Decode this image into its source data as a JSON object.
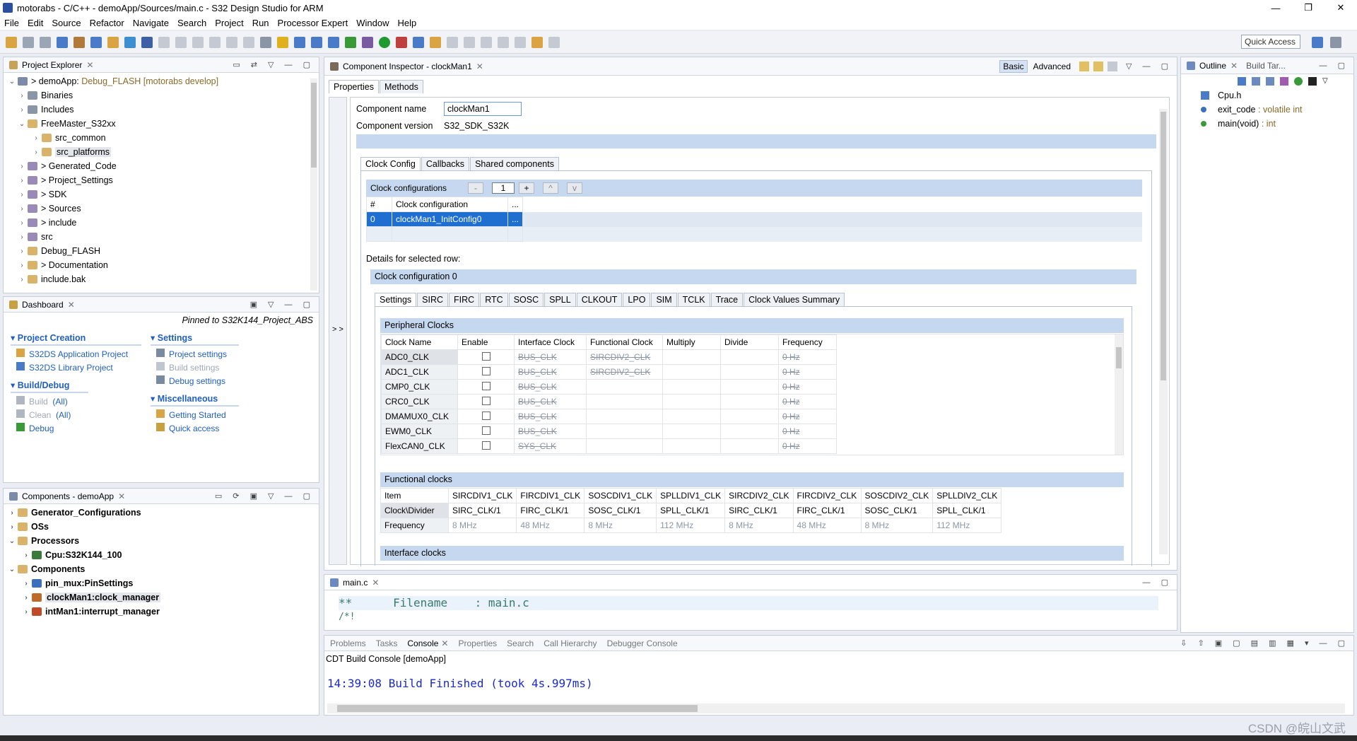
{
  "window": {
    "title": "motorabs - C/C++ - demoApp/Sources/main.c - S32 Design Studio for ARM",
    "controls": [
      "—",
      "❐",
      "✕"
    ]
  },
  "menu": [
    "File",
    "Edit",
    "Source",
    "Refactor",
    "Navigate",
    "Search",
    "Project",
    "Run",
    "Processor Expert",
    "Window",
    "Help"
  ],
  "toolbar": {
    "quick_access": "Quick Access"
  },
  "project_explorer": {
    "title": "Project Explorer",
    "items": [
      {
        "label": "> demoApp:",
        "extra": "Debug_FLASH [motorabs develop]"
      },
      {
        "label": "Binaries"
      },
      {
        "label": "Includes"
      },
      {
        "label": "FreeMaster_S32xx"
      },
      {
        "label": "src_common"
      },
      {
        "label": "src_platforms"
      },
      {
        "label": "> Generated_Code"
      },
      {
        "label": "> Project_Settings"
      },
      {
        "label": "> SDK"
      },
      {
        "label": "> Sources"
      },
      {
        "label": "> include"
      },
      {
        "label": "src"
      },
      {
        "label": "Debug_FLASH"
      },
      {
        "label": "> Documentation"
      },
      {
        "label": "include.bak"
      }
    ]
  },
  "dashboard": {
    "title": "Dashboard",
    "pinned": "Pinned to S32K144_Project_ABS",
    "project_creation": {
      "title": "Project Creation",
      "items": [
        "S32DS Application Project",
        "S32DS Library Project"
      ]
    },
    "build_debug": {
      "title": "Build/Debug",
      "items": [
        {
          "a": "Build",
          "b": "(All)"
        },
        {
          "a": "Clean",
          "b": "(All)"
        },
        {
          "a": "Debug",
          "b": ""
        }
      ]
    },
    "settings": {
      "title": "Settings",
      "items": [
        "Project settings",
        "Build settings",
        "Debug settings"
      ]
    },
    "misc": {
      "title": "Miscellaneous",
      "items": [
        "Getting Started",
        "Quick access"
      ]
    }
  },
  "components": {
    "title": "Components - demoApp",
    "items": [
      "Generator_Configurations",
      "OSs",
      "Processors",
      "Cpu:S32K144_100",
      "Components",
      "pin_mux:PinSettings",
      "clockMan1:clock_manager",
      "intMan1:interrupt_manager"
    ]
  },
  "inspector": {
    "title": "Component Inspector - clockMan1",
    "modes": [
      "Basic",
      "Advanced"
    ],
    "tabs": [
      "Properties",
      "Methods"
    ],
    "collapse": "> >",
    "name_label": "Component name",
    "name_value": "clockMan1",
    "version_label": "Component version",
    "version_value": "S32_SDK_S32K",
    "subtabs": [
      "Clock Config",
      "Callbacks",
      "Shared components"
    ],
    "clock_configs_label": "Clock configurations",
    "clock_configs_buttons": [
      "-",
      "1",
      "+",
      "^",
      "v"
    ],
    "cfg_headers": [
      "#",
      "Clock configuration",
      "..."
    ],
    "cfg_row": [
      "0",
      "clockMan1_InitConfig0",
      "..."
    ],
    "details_label": "Details for selected row:",
    "config0": "Clock configuration 0",
    "clock_tabs": [
      "Settings",
      "SIRC",
      "FIRC",
      "RTC",
      "SOSC",
      "SPLL",
      "CLKOUT",
      "LPO",
      "SIM",
      "TCLK",
      "Trace",
      "Clock Values Summary"
    ],
    "peripheral_title": "Peripheral Clocks",
    "peripheral_headers": [
      "Clock Name",
      "Enable",
      "Interface Clock",
      "Functional Clock",
      "Multiply",
      "Divide",
      "Frequency"
    ],
    "peripheral_rows": [
      [
        "ADC0_CLK",
        "BUS_CLK",
        "SIRCDIV2_CLK",
        "0 Hz"
      ],
      [
        "ADC1_CLK",
        "BUS_CLK",
        "SIRCDIV2_CLK",
        "0 Hz"
      ],
      [
        "CMP0_CLK",
        "BUS_CLK",
        "",
        "0 Hz"
      ],
      [
        "CRC0_CLK",
        "BUS_CLK",
        "",
        "0 Hz"
      ],
      [
        "DMAMUX0_CLK",
        "BUS_CLK",
        "",
        "0 Hz"
      ],
      [
        "EWM0_CLK",
        "BUS_CLK",
        "",
        "0 Hz"
      ],
      [
        "FlexCAN0_CLK",
        "SYS_CLK",
        "",
        "0 Hz"
      ]
    ],
    "functional_title": "Functional clocks",
    "functional_headers": [
      "Item",
      "SIRCDIV1_CLK",
      "FIRCDIV1_CLK",
      "SOSCDIV1_CLK",
      "SPLLDIV1_CLK",
      "SIRCDIV2_CLK",
      "FIRCDIV2_CLK",
      "SOSCDIV2_CLK",
      "SPLLDIV2_CLK"
    ],
    "functional_div": [
      "Clock\\Divider",
      "SIRC_CLK/1",
      "FIRC_CLK/1",
      "SOSC_CLK/1",
      "SPLL_CLK/1",
      "SIRC_CLK/1",
      "FIRC_CLK/1",
      "SOSC_CLK/1",
      "SPLL_CLK/1"
    ],
    "functional_freq": [
      "Frequency",
      "8 MHz",
      "48 MHz",
      "8 MHz",
      "112 MHz",
      "8 MHz",
      "48 MHz",
      "8 MHz",
      "112 MHz"
    ],
    "interface_title": "Interface clocks"
  },
  "outline": {
    "tabs": [
      "Outline",
      "Build Tar..."
    ],
    "items": [
      {
        "name": "Cpu.h",
        "type": ""
      },
      {
        "name": "exit_code",
        "type": ": volatile int"
      },
      {
        "name": "main(void)",
        "type": ": int"
      }
    ]
  },
  "editor": {
    "tab": "main.c",
    "lines": [
      "**      Filename    : main.c",
      "/*!"
    ]
  },
  "console": {
    "tabs": [
      "Problems",
      "Tasks",
      "Console",
      "Properties",
      "Search",
      "Call Hierarchy",
      "Debugger Console"
    ],
    "header": "CDT Build Console [demoApp]",
    "output": "14:39:08 Build Finished (took 4s.997ms)"
  },
  "watermark": "CSDN @皖山文武"
}
